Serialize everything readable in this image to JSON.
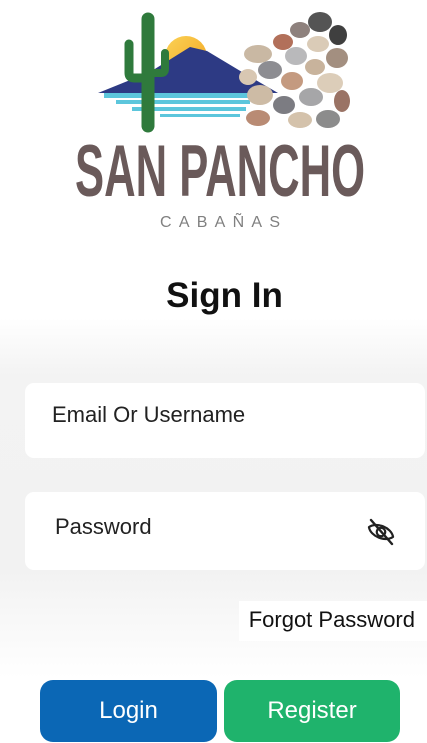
{
  "brand": {
    "name": "SAN PANCHO",
    "subtitle": "CABAÑAS",
    "text_color": "#6a5a5a",
    "subtitle_color": "#808080"
  },
  "page": {
    "heading": "Sign In"
  },
  "form": {
    "email": {
      "placeholder": "Email Or Username",
      "value": ""
    },
    "password": {
      "placeholder": "Password",
      "value": "",
      "visibility_icon": "eye-off-icon"
    },
    "forgot_password_label": "Forgot Password"
  },
  "actions": {
    "login": {
      "label": "Login",
      "color": "#0b67b5"
    },
    "register": {
      "label": "Register",
      "color": "#1fb36c"
    }
  }
}
